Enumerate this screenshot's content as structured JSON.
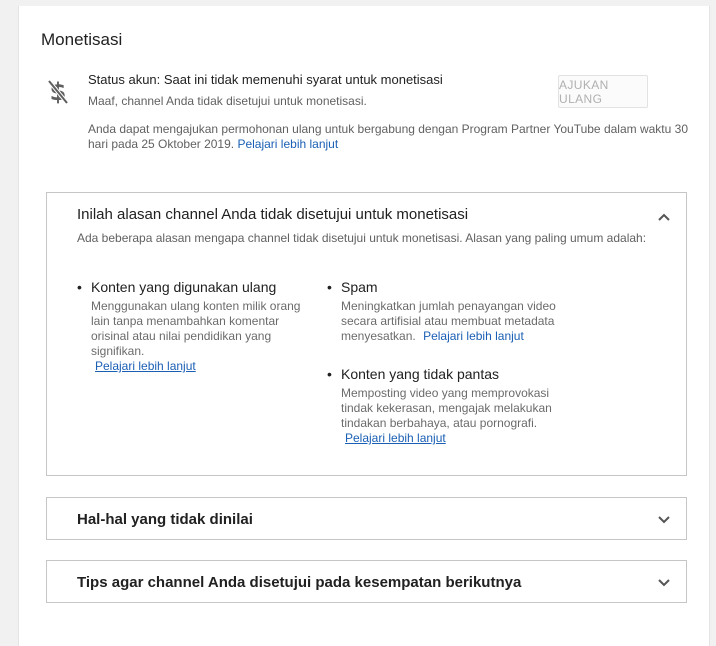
{
  "monetization": {
    "title": "Monetisasi",
    "status_icon": "no-dollar-icon",
    "status_line": "Status akun: Saat ini tidak memenuhi syarat untuk monetisasi",
    "status_sub": "Maaf, channel Anda tidak disetujui untuk monetisasi.",
    "appeal_note": "Anda dapat mengajukan permohonan ulang untuk bergabung dengan Program Partner YouTube dalam waktu 30 hari pada 25 Oktober 2019.",
    "learn_more": "Pelajari lebih lanjut",
    "appeal_button": "AJUKAN ULANG"
  },
  "reasons_panel": {
    "title": "Inilah alasan channel Anda tidak disetujui untuk monetisasi",
    "intro": "Ada beberapa alasan mengapa channel tidak disetujui untuk monetisasi. Alasan yang paling umum adalah:",
    "reasons": [
      {
        "title": "Konten yang digunakan ulang",
        "desc": "Menggunakan ulang konten milik orang lain tanpa menambahkan komentar orisinal atau nilai pendidikan yang signifikan.",
        "link": "Pelajari lebih lanjut"
      },
      {
        "title": "Spam",
        "desc": "Meningkatkan jumlah penayangan video secara artifisial atau membuat metadata menyesatkan.",
        "link": "Pelajari lebih lanjut"
      },
      {
        "title": "Konten yang tidak pantas",
        "desc": "Memposting video yang memprovokasi tindak kekerasan, mengajak melakukan tindakan berbahaya, atau pornografi.",
        "link": "Pelajari lebih lanjut"
      }
    ]
  },
  "panel_not_rated": {
    "title": "Hal-hal yang tidak dinilai"
  },
  "panel_tips": {
    "title": "Tips agar channel Anda disetujui pada kesempatan berikutnya"
  },
  "colors": {
    "link": "#1a5fb4",
    "border": "#c6c6c6"
  }
}
